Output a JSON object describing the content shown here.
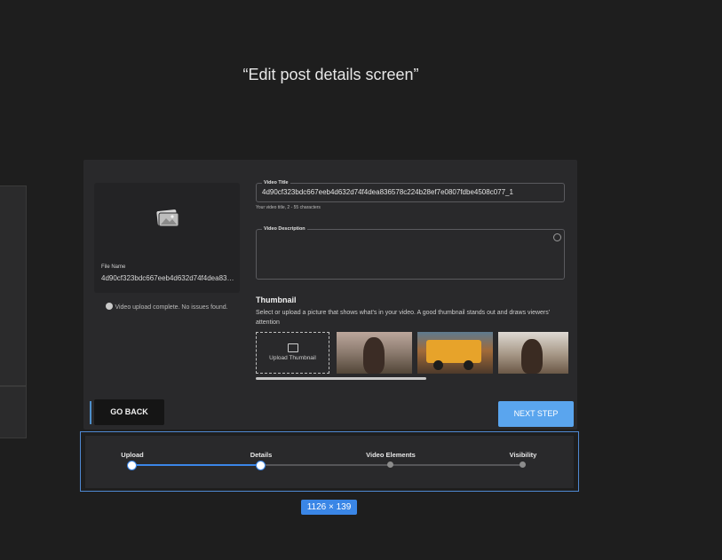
{
  "caption": "“Edit post details screen”",
  "preview": {
    "file_label": "File Name",
    "file_name": "4d90cf323bdc667eeb4d632d74f4dea836578c224b28ef7e0807fdbe4508c077_1",
    "upload_status": "Video upload complete. No issues found."
  },
  "form": {
    "title_label": "Video Title",
    "title_value": "4d90cf323bdc667eeb4d632d74f4dea836578c224b28ef7e0807fdbe4508c077_1",
    "title_hint": "Your video title, 2 - 55 characters",
    "description_label": "Video Description",
    "description_value": ""
  },
  "thumbnail": {
    "heading": "Thumbnail",
    "description": "Select or upload a picture that shows what's in your video. A good thumbnail stands out and draws viewers' attention",
    "upload_label": "Upload Thumbnail"
  },
  "buttons": {
    "back": "GO BACK",
    "next": "NEXT STEP"
  },
  "stepper": {
    "steps": [
      {
        "label": "Upload",
        "state": "complete"
      },
      {
        "label": "Details",
        "state": "current"
      },
      {
        "label": "Video Elements",
        "state": "upcoming"
      },
      {
        "label": "Visibility",
        "state": "upcoming"
      }
    ]
  },
  "selection_size": "1126 × 139",
  "colors": {
    "accent": "#5aa5ee",
    "step_active": "#3b86e8",
    "background": "#1e1e1e",
    "panel": "#29292b"
  }
}
